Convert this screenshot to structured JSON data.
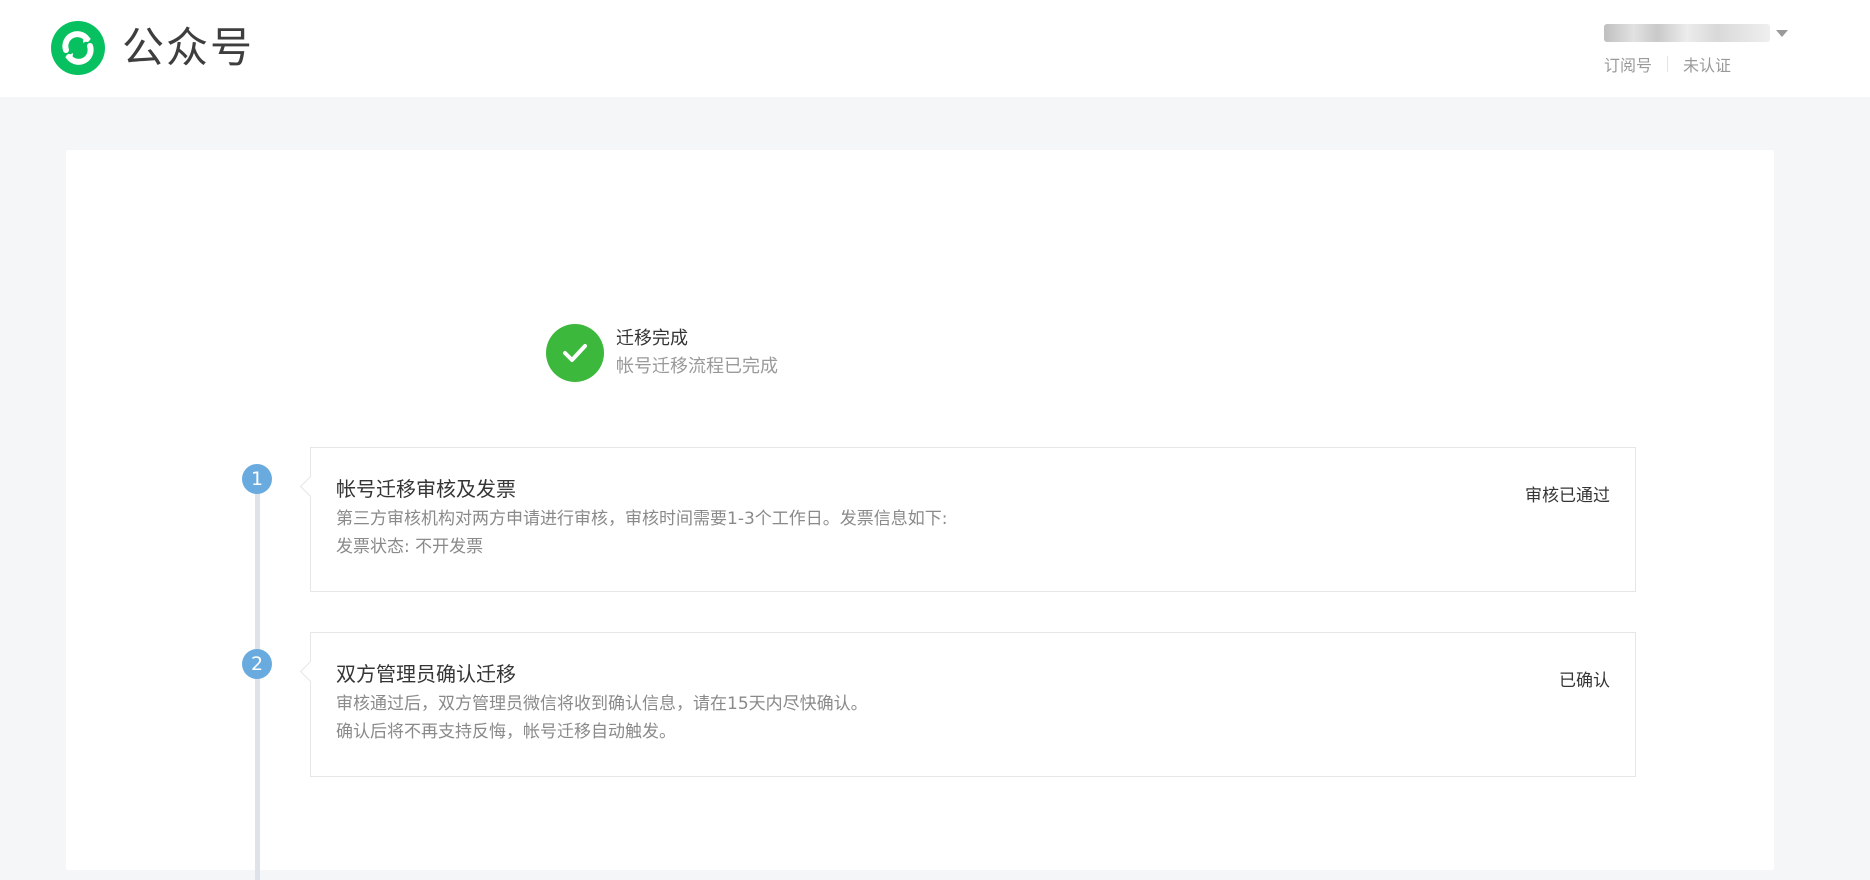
{
  "header": {
    "brand": "公众号",
    "account": {
      "type": "订阅号",
      "verification": "未认证"
    }
  },
  "status": {
    "title": "迁移完成",
    "description": "帐号迁移流程已完成",
    "color": "#3cb83c"
  },
  "steps": [
    {
      "number": "1",
      "title": "帐号迁移审核及发票",
      "lines": [
        "第三方审核机构对两方申请进行审核，审核时间需要1-3个工作日。发票信息如下:",
        "发票状态:  不开发票"
      ],
      "status": "审核已通过"
    },
    {
      "number": "2",
      "title": "双方管理员确认迁移",
      "lines": [
        "审核通过后，双方管理员微信将收到确认信息，请在15天内尽快确认。",
        "确认后将不再支持反悔，帐号迁移自动触发。"
      ],
      "status": "已确认"
    }
  ],
  "colors": {
    "accent": "#07c160",
    "step": "#6aabdf"
  }
}
